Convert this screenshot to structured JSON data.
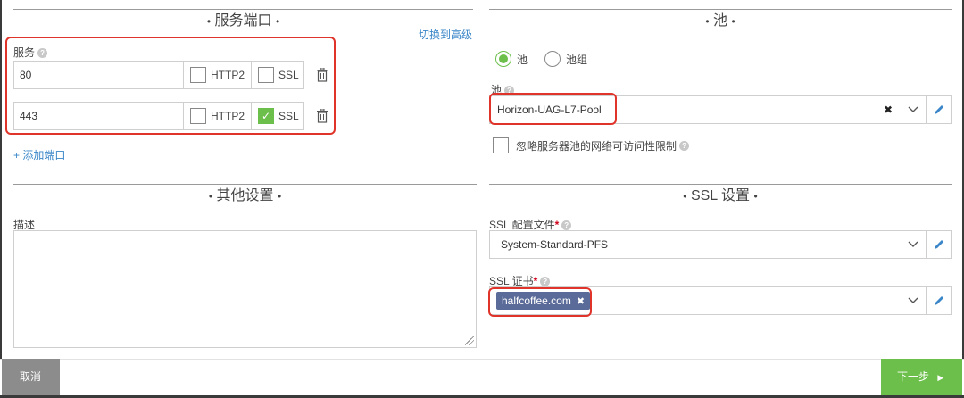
{
  "service_ports": {
    "title": "服务端口",
    "switch_link": "切换到高级",
    "service_label": "服务",
    "ports": [
      {
        "value": "80",
        "http2_label": "HTTP2",
        "http2_checked": false,
        "ssl_label": "SSL",
        "ssl_checked": false
      },
      {
        "value": "443",
        "http2_label": "HTTP2",
        "http2_checked": false,
        "ssl_label": "SSL",
        "ssl_checked": true
      }
    ],
    "add_port": "+ 添加端口"
  },
  "pool": {
    "title": "池",
    "radio_pool": "池",
    "radio_pool_group": "池组",
    "selected_radio": "池",
    "pool_label": "池",
    "pool_value": "Horizon-UAG-L7-Pool",
    "ignore_label": "忽略服务器池的网络可访问性限制"
  },
  "other": {
    "title": "其他设置",
    "description_label": "描述",
    "description_value": ""
  },
  "ssl": {
    "title": "SSL 设置",
    "profile_label": "SSL 配置文件",
    "profile_value": "System-Standard-PFS",
    "cert_label": "SSL 证书",
    "cert_tag": "halfcoffee.com"
  },
  "footer": {
    "cancel": "取消",
    "next": "下一步"
  },
  "colors": {
    "accent_green": "#6cbf4a",
    "link_blue": "#3a86c8",
    "highlight_red": "#e0342a",
    "tag_bg": "#5b6b99",
    "cancel_gray": "#8c8c8c"
  }
}
